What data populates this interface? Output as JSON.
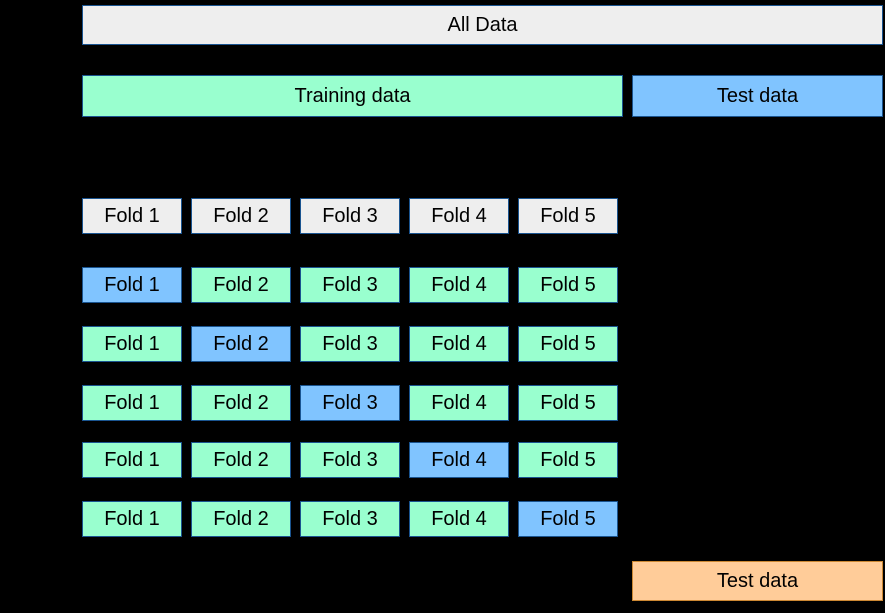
{
  "all_data_label": "All Data",
  "training_data_label": "Training data",
  "test_data_label": "Test data",
  "folds": {
    "labels": [
      "Fold 1",
      "Fold 2",
      "Fold 3",
      "Fold 4",
      "Fold 5"
    ],
    "header_style": [
      "grey",
      "grey",
      "grey",
      "grey",
      "grey"
    ],
    "splits": [
      [
        "blue",
        "green",
        "green",
        "green",
        "green"
      ],
      [
        "green",
        "blue",
        "green",
        "green",
        "green"
      ],
      [
        "green",
        "green",
        "blue",
        "green",
        "green"
      ],
      [
        "green",
        "green",
        "green",
        "blue",
        "green"
      ],
      [
        "green",
        "green",
        "green",
        "green",
        "blue"
      ]
    ]
  },
  "colors": {
    "grey": "#eeeeee",
    "green": "#99ffcf",
    "blue": "#80c4ff",
    "orange": "#ffcc99",
    "border": "#1a5490"
  }
}
